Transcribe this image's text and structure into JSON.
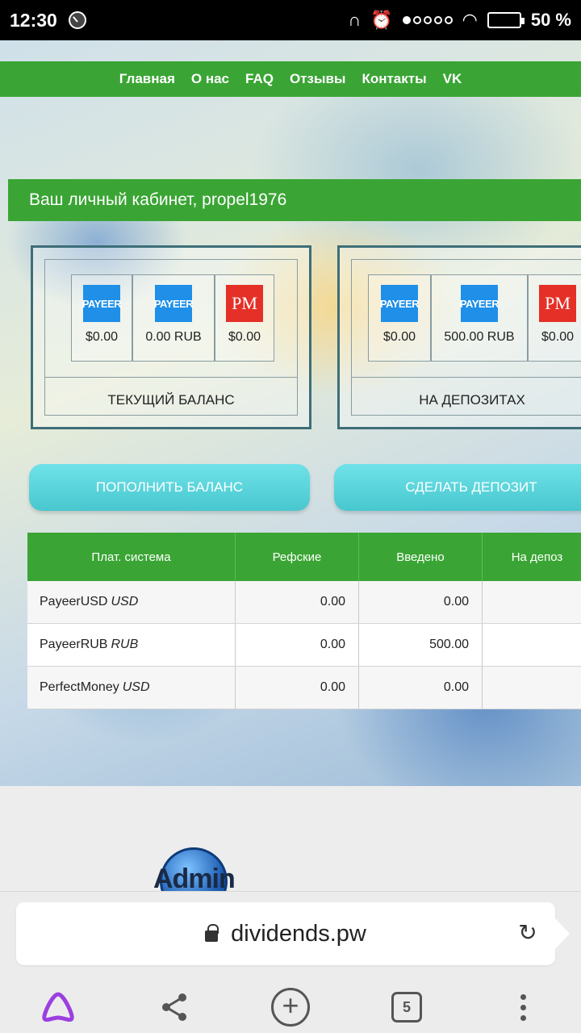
{
  "status": {
    "time": "12:30",
    "battery": "50 %",
    "battery_level": 0.5
  },
  "nav": {
    "items": [
      "Главная",
      "О нас",
      "FAQ",
      "Отзывы",
      "Контакты",
      "VK"
    ]
  },
  "cabinet": {
    "title": "Ваш личный кабинет, propel1976"
  },
  "balance_panel": {
    "caption": "ТЕКУЩИЙ БАЛАНС",
    "cells": [
      {
        "logo": "PAYEER",
        "amount": "$0.00"
      },
      {
        "logo": "PAYEER",
        "amount": "0.00 RUB"
      },
      {
        "logo": "PM",
        "amount": "$0.00"
      }
    ]
  },
  "deposit_panel": {
    "caption": "НА ДЕПОЗИТАХ",
    "cells": [
      {
        "logo": "PAYEER",
        "amount": "$0.00"
      },
      {
        "logo": "PAYEER",
        "amount": "500.00 RUB"
      },
      {
        "logo": "PM",
        "amount": "$0.00"
      }
    ]
  },
  "buttons": {
    "top_up": "ПОПОЛНИТЬ БАЛАНС",
    "make_deposit": "СДЕЛАТЬ ДЕПОЗИТ"
  },
  "table": {
    "headers": [
      "Плат. система",
      "Рефские",
      "Введено",
      "На депоз"
    ],
    "rows": [
      {
        "system": "PayeerUSD",
        "currency": "USD",
        "ref": "0.00",
        "entered": "0.00"
      },
      {
        "system": "PayeerRUB",
        "currency": "RUB",
        "ref": "0.00",
        "entered": "500.00"
      },
      {
        "system": "PerfectMoney",
        "currency": "USD",
        "ref": "0.00",
        "entered": "0.00"
      }
    ]
  },
  "footer_logo": "Admin",
  "browser": {
    "url": "dividends.pw",
    "tab_count": "5"
  },
  "colors": {
    "nav_green": "#3aa534",
    "button_cyan": "#5ad4db",
    "payeer_blue": "#1f8fe8",
    "pm_red": "#e53027"
  }
}
